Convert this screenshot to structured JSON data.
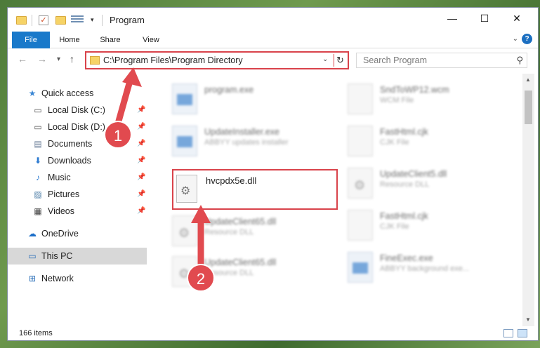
{
  "window": {
    "title": "Program",
    "controls": {
      "minimize": "—",
      "maximize": "☐",
      "close": "✕"
    }
  },
  "ribbon": {
    "tabs": [
      "File",
      "Home",
      "Share",
      "View"
    ],
    "help_chevron": "⌄",
    "help_icon": "?"
  },
  "nav": {
    "address_path": "C:\\Program Files\\Program Directory",
    "search_placeholder": "Search Program"
  },
  "sidebar": {
    "items": [
      {
        "label": "Quick access",
        "icon": "star-icon",
        "pinned": false
      },
      {
        "label": "Local Disk (C:)",
        "icon": "drive-icon",
        "pinned": true
      },
      {
        "label": "Local Disk (D:)",
        "icon": "drive-icon",
        "pinned": true
      },
      {
        "label": "Documents",
        "icon": "documents-icon",
        "pinned": true
      },
      {
        "label": "Downloads",
        "icon": "download-icon",
        "pinned": true
      },
      {
        "label": "Music",
        "icon": "music-icon",
        "pinned": true
      },
      {
        "label": "Pictures",
        "icon": "pictures-icon",
        "pinned": true
      },
      {
        "label": "Videos",
        "icon": "videos-icon",
        "pinned": true
      },
      {
        "label": "OneDrive",
        "icon": "cloud-icon",
        "pinned": false
      },
      {
        "label": "This PC",
        "icon": "computer-icon",
        "pinned": false,
        "selected": true
      },
      {
        "label": "Network",
        "icon": "network-icon",
        "pinned": false
      }
    ]
  },
  "files": {
    "left": [
      {
        "name": "program.exe",
        "type": ""
      },
      {
        "name": "UpdateInstaller.exe",
        "type": "ABBYY updates installer"
      },
      {
        "name": "hvcpdx5e.dll",
        "type": ""
      },
      {
        "name": "UpdateClient65.dll",
        "type": "Resource DLL"
      },
      {
        "name": "UpdateClient65.dll",
        "type": "Resource DLL"
      }
    ],
    "right": [
      {
        "name": "SndToWP12.wcm",
        "type": "WCM File"
      },
      {
        "name": "FastHtml.cjk",
        "type": "CJK File"
      },
      {
        "name": "UpdateClient5.dll",
        "type": "Resource DLL"
      },
      {
        "name": "FastHtml.cjk",
        "type": "CJK File"
      },
      {
        "name": "FineExec.exe",
        "type": "ABBYY background exe..."
      }
    ]
  },
  "status": {
    "item_count": "166 items"
  },
  "annotations": {
    "step1": "1",
    "step2": "2"
  },
  "colors": {
    "accent": "#1979ca",
    "highlight": "#d9434b",
    "marker": "#e14a4f"
  }
}
